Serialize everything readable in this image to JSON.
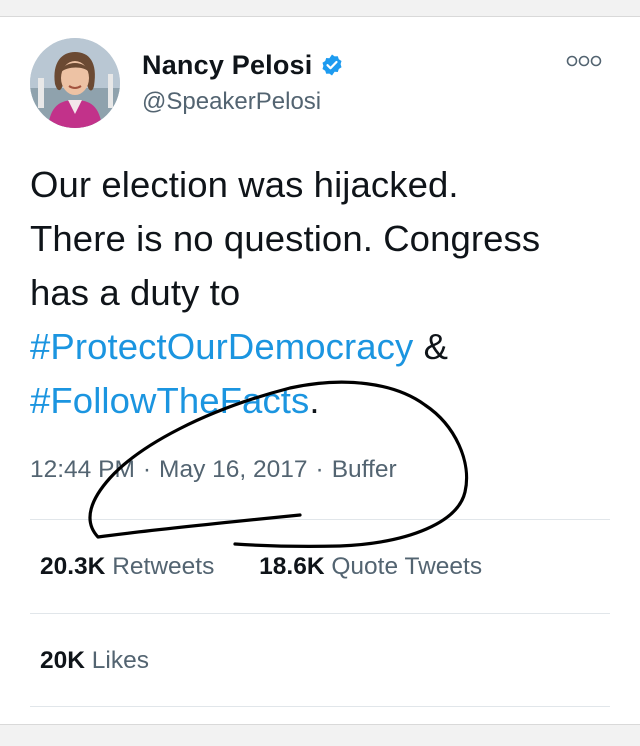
{
  "tweet": {
    "author": {
      "display_name": "Nancy Pelosi",
      "handle": "@SpeakerPelosi",
      "verified": true,
      "avatar_icon": "profile-photo"
    },
    "text": {
      "line1": "Our election was hijacked.",
      "line2": "There is no question. Congress",
      "line3": "has a duty to",
      "hashtag1": "#ProtectOurDemocracy",
      "amp": "&",
      "hashtag2": "#FollowTheFacts",
      "period": "."
    },
    "meta": {
      "time": "12:44 PM",
      "separator": "·",
      "date": "May 16, 2017",
      "source": "Buffer"
    },
    "stats": {
      "retweets_count": "20.3K",
      "retweets_label": "Retweets",
      "quotes_count": "18.6K",
      "quotes_label": "Quote Tweets",
      "likes_count": "20K",
      "likes_label": "Likes"
    }
  },
  "colors": {
    "hashtag": "#1b95e0",
    "verified": "#1d9bf0",
    "secondary_text": "#536471",
    "primary_text": "#0f1419",
    "annotation_ink": "#000000"
  },
  "icons": {
    "verified": "verified-badge-icon",
    "more": "more-options-icon"
  }
}
